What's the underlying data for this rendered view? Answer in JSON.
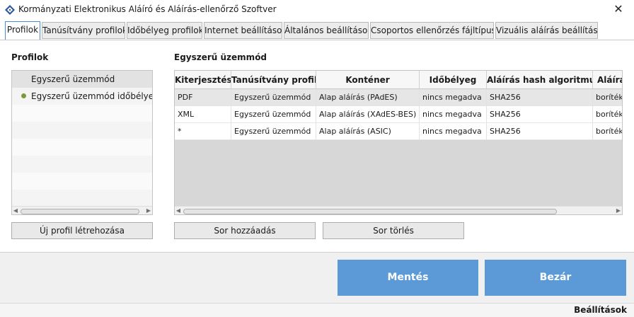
{
  "window": {
    "title": "Kormányzati Elektronikus Aláíró és Aláírás-ellenőrző Szoftver",
    "close_label": "✕"
  },
  "tabs": [
    {
      "label": "Profilok",
      "active": true
    },
    {
      "label": "Tanúsítvány profilok"
    },
    {
      "label": "Időbélyeg profilok"
    },
    {
      "label": "Internet beállítások"
    },
    {
      "label": "Általános beállítások"
    },
    {
      "label": "Csoportos ellenőrzés fájltípusai"
    },
    {
      "label": "Vizuális aláírás beállítások"
    }
  ],
  "profiles": {
    "title": "Profilok",
    "items": [
      {
        "label": "Egyszerű üzemmód",
        "selected": true,
        "bullet": false
      },
      {
        "label": "Egyszerű üzemmód időbélyeggel",
        "selected": false,
        "bullet": true
      }
    ],
    "new_button": "Új profil létrehozása"
  },
  "detail": {
    "title": "Egyszerű üzemmód",
    "columns": [
      "Kiterjesztés",
      "Tanúsítvány profil",
      "Konténer",
      "Időbélyeg",
      "Aláírás hash algoritmusa",
      "Aláírás"
    ],
    "rows": [
      [
        "PDF",
        "Egyszerű üzemmód",
        "Alap aláírás (PAdES)",
        "nincs megadva",
        "SHA256",
        "borítékolt"
      ],
      [
        "XML",
        "Egyszerű üzemmód",
        "Alap aláírás (XAdES-BES)",
        "nincs megadva",
        "SHA256",
        "borítékolt"
      ],
      [
        "*",
        "Egyszerű üzemmód",
        "Alap aláírás (ASIC)",
        "nincs megadva",
        "SHA256",
        "borítékolt"
      ]
    ],
    "add_row_button": "Sor hozzáadás",
    "delete_row_button": "Sor törlés"
  },
  "footer": {
    "save_button": "Mentés",
    "close_button": "Bezár"
  },
  "status": {
    "text": "Beállítások"
  },
  "colors": {
    "accent": "#5b9ad7",
    "tab_border": "#4a8ad8",
    "bullet": "#7a9a3a"
  }
}
